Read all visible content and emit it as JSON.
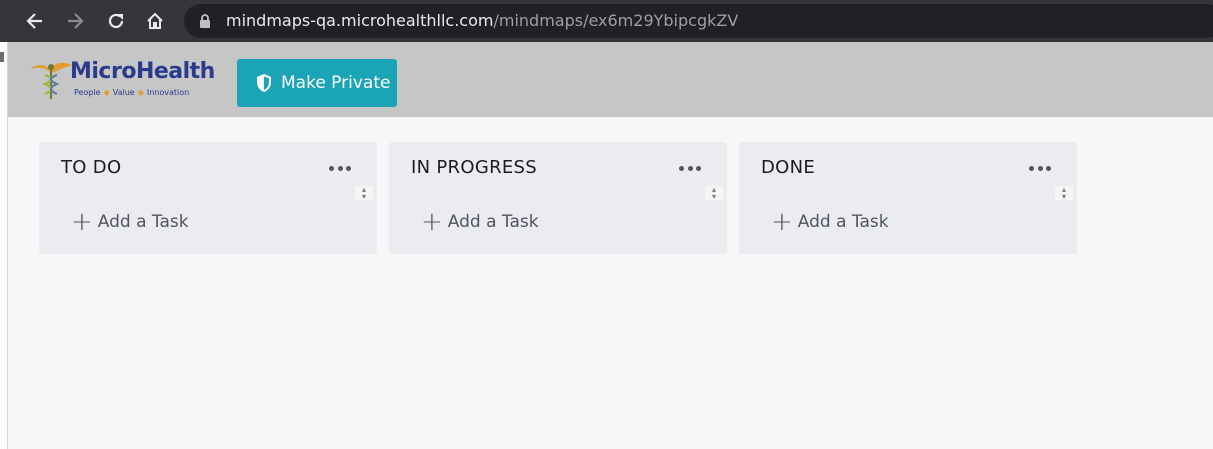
{
  "browser": {
    "url_host": "mindmaps-qa.microhealthllc.com",
    "url_path": "/mindmaps/ex6m29YbipcgkZV",
    "icons": [
      "back-icon",
      "forward-icon",
      "reload-icon",
      "home-icon",
      "lock-icon"
    ]
  },
  "header": {
    "logo_text": "MicroHealth",
    "logo_tagline": [
      "People",
      "Value",
      "Innovation"
    ],
    "make_private_label": "Make Private",
    "colors": {
      "header_bg": "#c6c6c6",
      "button": "#1ba4b5",
      "logo_blue": "#2a3a8c",
      "logo_orange": "#e69a30"
    }
  },
  "board": {
    "columns": [
      {
        "title": "TO DO",
        "add_label": "Add a Task"
      },
      {
        "title": "IN PROGRESS",
        "add_label": "Add a Task"
      },
      {
        "title": "DONE",
        "add_label": "Add a Task"
      }
    ]
  }
}
